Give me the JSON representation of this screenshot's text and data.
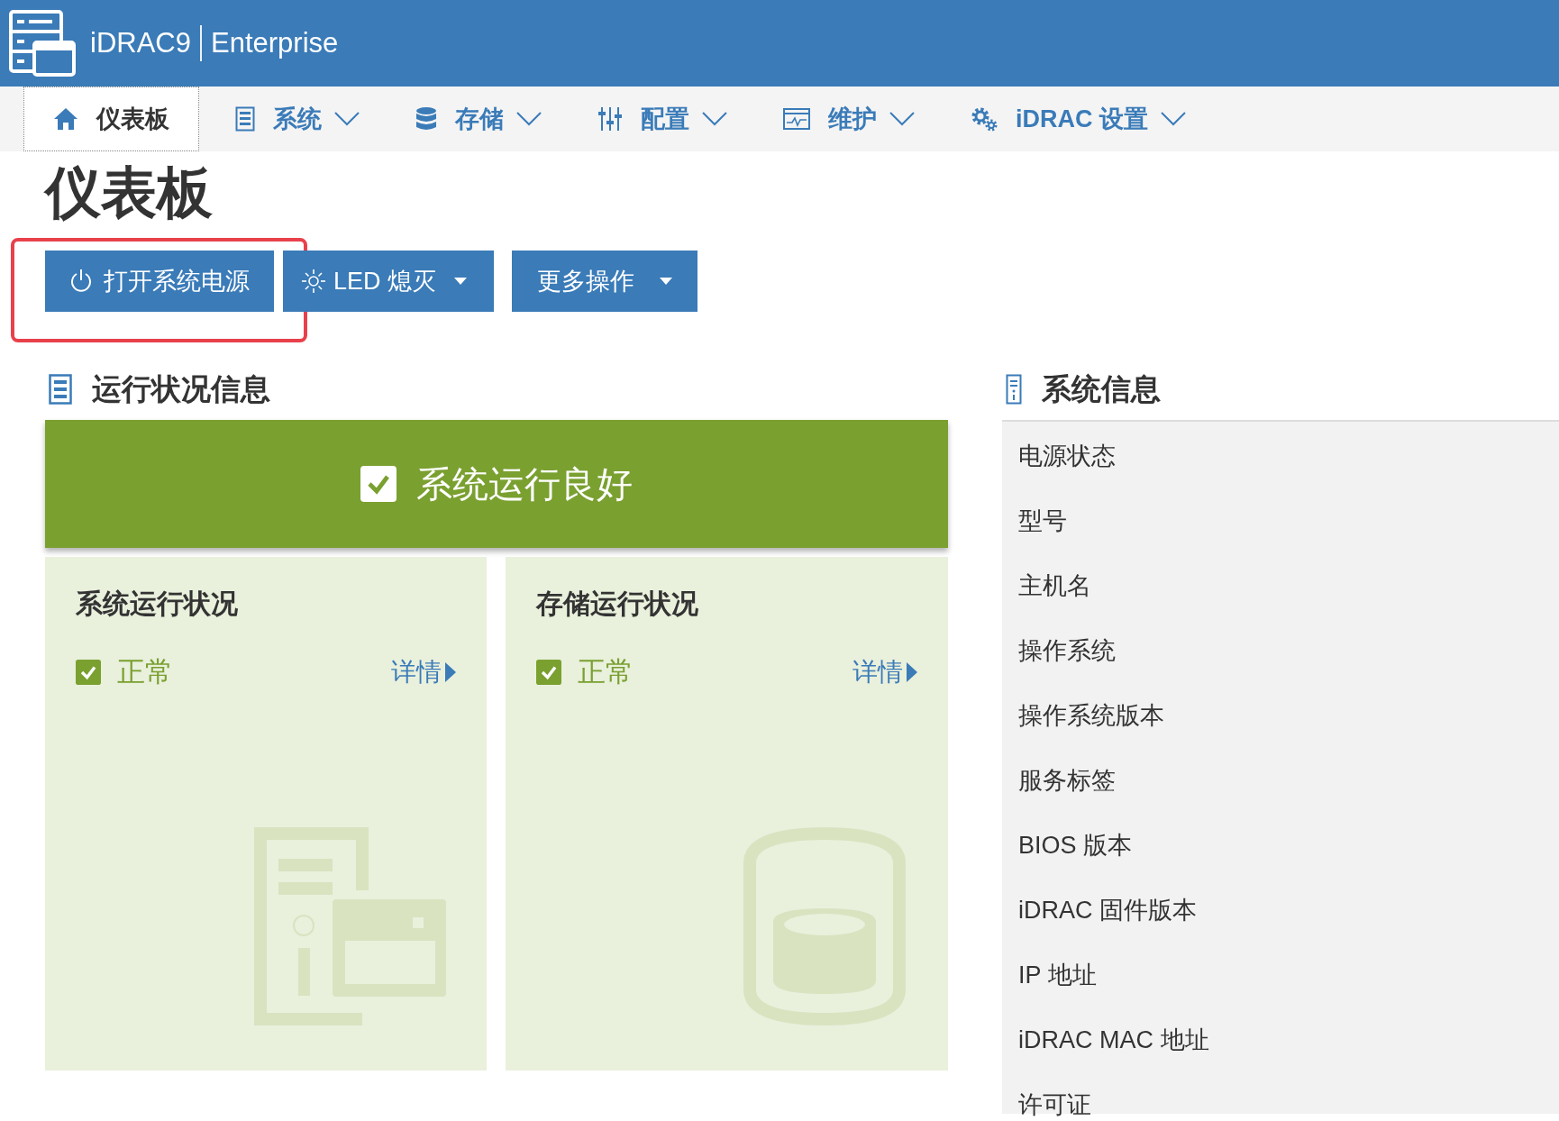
{
  "header": {
    "product": "iDRAC9",
    "edition": "Enterprise"
  },
  "nav_tabs": [
    {
      "label": "仪表板",
      "kind": "home",
      "selected": true,
      "has_menu": false
    },
    {
      "label": "系统",
      "kind": "server",
      "selected": false,
      "has_menu": true
    },
    {
      "label": "存储",
      "kind": "database",
      "selected": false,
      "has_menu": true
    },
    {
      "label": "配置",
      "kind": "sliders",
      "selected": false,
      "has_menu": true
    },
    {
      "label": "维护",
      "kind": "monitor",
      "selected": false,
      "has_menu": true
    },
    {
      "label": "iDRAC 设置",
      "kind": "gears",
      "selected": false,
      "has_menu": true
    }
  ],
  "page_title": "仪表板",
  "actions": [
    {
      "label": "打开系统电源",
      "kind": "power",
      "dropdown": false,
      "highlighted": true
    },
    {
      "label": "LED 熄灭",
      "kind": "led",
      "dropdown": true,
      "highlighted": false
    },
    {
      "label": "更多操作",
      "kind": "plain",
      "dropdown": true,
      "highlighted": false
    }
  ],
  "health": {
    "title": "运行状况信息",
    "banner": {
      "text": "系统运行良好",
      "checked": true
    },
    "cards": [
      {
        "title": "系统运行状况",
        "status": "正常",
        "checked": true,
        "link": "详情",
        "kind": "server"
      },
      {
        "title": "存储运行状况",
        "status": "正常",
        "checked": true,
        "link": "详情",
        "kind": "storage"
      }
    ]
  },
  "system_info": {
    "title": "系统信息",
    "items": [
      "电源状态",
      "型号",
      "主机名",
      "操作系统",
      "操作系统版本",
      "服务标签",
      "BIOS 版本",
      "iDRAC 固件版本",
      "IP 地址",
      "iDRAC MAC 地址",
      "许可证"
    ]
  }
}
